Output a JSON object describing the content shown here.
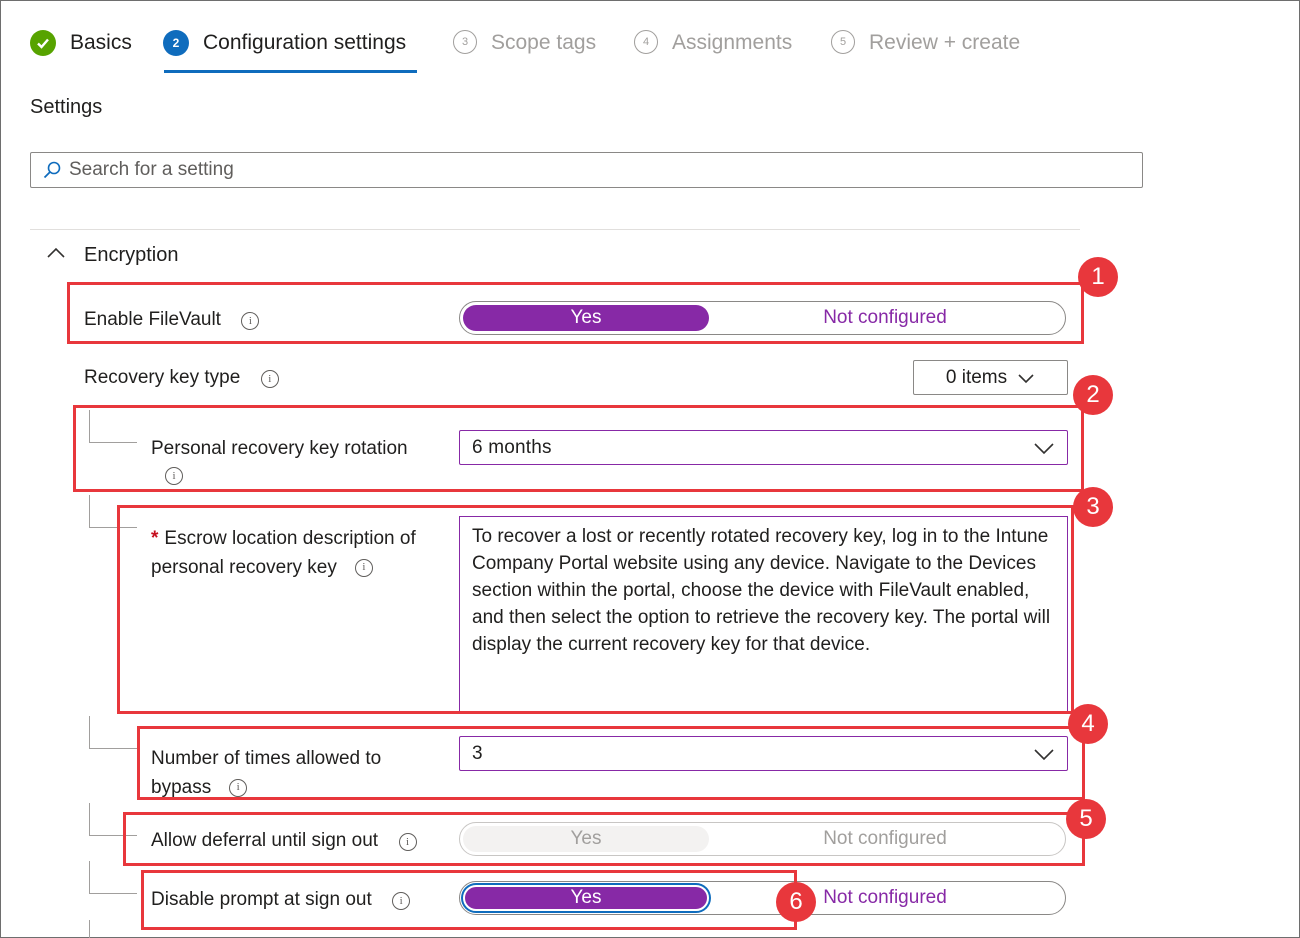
{
  "wizard": {
    "steps": [
      {
        "number": "",
        "label": "Basics",
        "state": "done"
      },
      {
        "number": "2",
        "label": "Configuration settings",
        "state": "active"
      },
      {
        "number": "3",
        "label": "Scope tags",
        "state": "pending"
      },
      {
        "number": "4",
        "label": "Assignments",
        "state": "pending"
      },
      {
        "number": "5",
        "label": "Review + create",
        "state": "pending"
      }
    ]
  },
  "settings_title": "Settings",
  "search": {
    "placeholder": "Search for a setting",
    "value": ""
  },
  "section": {
    "label": "Encryption",
    "expanded": true
  },
  "fields": {
    "enable_filevault": {
      "label": "Enable FileVault",
      "yes": "Yes",
      "no": "Not configured",
      "selected": "Yes"
    },
    "recovery_key_type": {
      "label": "Recovery key type",
      "value": "0 items"
    },
    "personal_recovery_key_rotation": {
      "label": "Personal recovery key rotation",
      "value": "6 months"
    },
    "escrow_location": {
      "required_mark": "*",
      "label_line1": "Escrow location description of",
      "label_line2": "personal recovery key",
      "value": "To recover a lost or recently rotated recovery key, log in to the Intune Company Portal website using any device. Navigate to the Devices section within the portal, choose the device with FileVault enabled, and then select the option to retrieve the recovery key. The portal will display the current recovery key for that device."
    },
    "bypass_count": {
      "label_line1": "Number of times allowed to",
      "label_line2": "bypass",
      "value": "3"
    },
    "allow_deferral": {
      "label": "Allow deferral until sign out",
      "yes": "Yes",
      "no": "Not configured",
      "selected": "none"
    },
    "disable_prompt": {
      "label": "Disable prompt at sign out",
      "yes": "Yes",
      "no": "Not configured",
      "selected": "Yes"
    }
  },
  "annotations": {
    "badges": [
      "1",
      "2",
      "3",
      "4",
      "5",
      "6"
    ],
    "color": "#e8373c"
  },
  "colors": {
    "accent": "#8729a6",
    "primary": "#0f6cbd",
    "success": "#57a300"
  }
}
